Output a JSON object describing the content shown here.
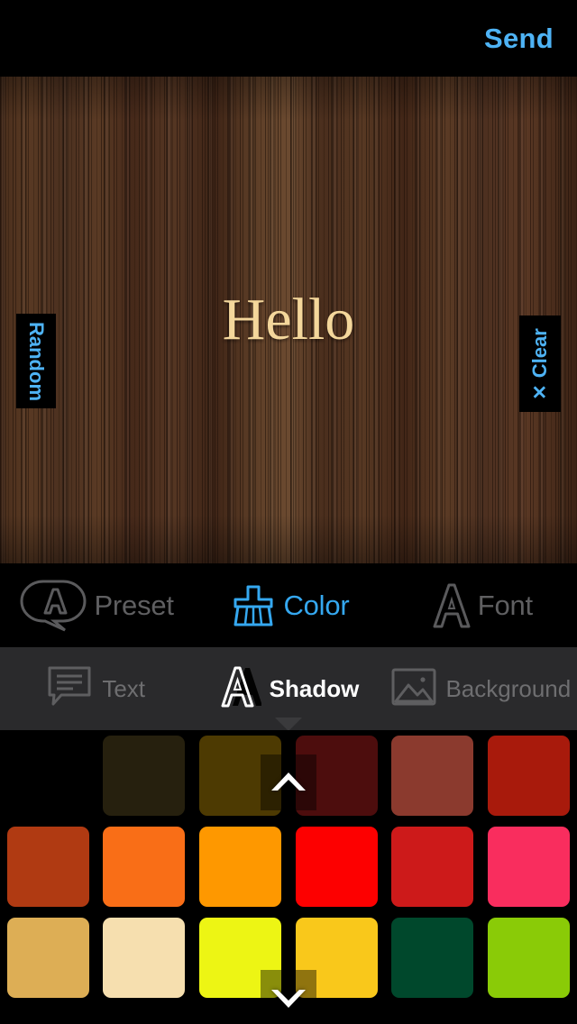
{
  "topbar": {
    "send_label": "Send"
  },
  "canvas": {
    "text": "Hello",
    "text_color": "#F4D79B",
    "background_kind": "wood-texture",
    "random_button": {
      "label": "Random",
      "icon": ""
    },
    "clear_button": {
      "label": "Clear",
      "icon": "✕"
    }
  },
  "primary_tabs": [
    {
      "label": "Preset",
      "icon": "speech-bubble-a-icon",
      "active": false,
      "color": "#5F5F61"
    },
    {
      "label": "Color",
      "icon": "brush-icon",
      "active": true,
      "color": "#35A8F0"
    },
    {
      "label": "Font",
      "icon": "letter-a-icon",
      "active": false,
      "color": "#5F5F61"
    }
  ],
  "secondary_tabs": [
    {
      "label": "Text",
      "icon": "speech-lines-icon",
      "active": false,
      "color": "#6E6E70"
    },
    {
      "label": "Shadow",
      "icon": "letter-a-shadow-icon",
      "active": true,
      "color": "#FFFFFF"
    },
    {
      "label": "Background",
      "icon": "photo-icon",
      "active": false,
      "color": "#6E6E70"
    }
  ],
  "swatches": {
    "scroll_up_icon": "chevron-up-icon",
    "scroll_down_icon": "chevron-down-icon",
    "rows": [
      [
        "",
        "#26200E",
        "#4D3A02",
        "#4D0D0D",
        "#8B3A2E",
        "#A81A0C"
      ],
      [
        "#B03A12",
        "#F96E17",
        "#FE9800",
        "#FD0000",
        "#CD1A1A",
        "#F92D5E"
      ],
      [
        "#DDAE55",
        "#F6DFAF",
        "#EDF514",
        "#F9C81B",
        "#00482C",
        "#8ACB07"
      ]
    ]
  }
}
